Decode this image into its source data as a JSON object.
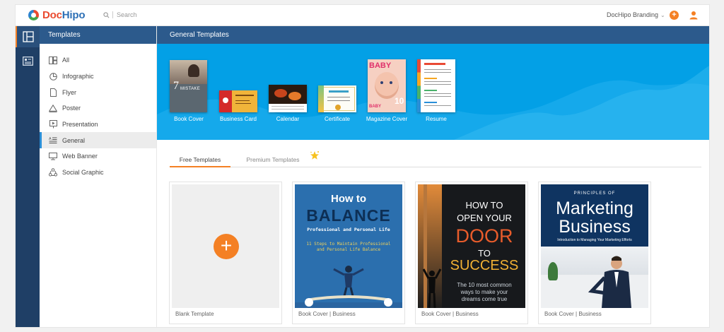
{
  "topbar": {
    "logo_doc": "Doc",
    "logo_hipo": "Hipo",
    "search_placeholder": "Search",
    "brand_label": "DocHipo Branding",
    "plus": "+"
  },
  "sidebar": {
    "title": "Templates",
    "items": [
      {
        "label": "All",
        "icon": "grid-icon"
      },
      {
        "label": "Infographic",
        "icon": "pie-chart-icon"
      },
      {
        "label": "Flyer",
        "icon": "flyer-icon"
      },
      {
        "label": "Poster",
        "icon": "poster-icon"
      },
      {
        "label": "Presentation",
        "icon": "presentation-icon"
      },
      {
        "label": "General",
        "icon": "general-doc-icon"
      },
      {
        "label": "Web Banner",
        "icon": "monitor-icon"
      },
      {
        "label": "Social Graphic",
        "icon": "social-graphic-icon"
      }
    ],
    "active_index": 5
  },
  "main": {
    "title": "General Templates",
    "template_types": [
      {
        "label": "Book Cover"
      },
      {
        "label": "Business Card"
      },
      {
        "label": "Calendar"
      },
      {
        "label": "Certificate"
      },
      {
        "label": "Magazine Cover"
      },
      {
        "label": "Resume"
      }
    ],
    "tabs": [
      {
        "label": "Free Templates",
        "active": true
      },
      {
        "label": "Premium Templates",
        "active": false
      }
    ],
    "cards": [
      {
        "caption": "Blank Template",
        "add": "+"
      },
      {
        "caption": "Book Cover | Business",
        "line1": "How to",
        "line2": "BALANCE",
        "line3": "Professional and Personal Life",
        "line4": "11 Steps to Maintain Professional",
        "line5": "and Personal Life Balance"
      },
      {
        "caption": "Book Cover | Business",
        "line1": "HOW TO",
        "line2": "OPEN YOUR",
        "line3": "DOOR",
        "line4": "TO",
        "line5": "SUCCESS",
        "line6": "The 10 most common",
        "line7": "ways to make your",
        "line8": "dreams come true"
      },
      {
        "caption": "Book Cover | Business",
        "line1": "PRINCIPLES OF",
        "line2": "Marketing",
        "line3": "Business",
        "line4": "Introduction to Managing Your Marketing Efforts"
      }
    ],
    "thumb_text": {
      "book": "7",
      "book_sub": "MISTAKE",
      "baby": "BABY",
      "baby_num": "10"
    }
  },
  "colors": {
    "accent": "#f48024",
    "nav_dark": "#1f3f66",
    "header_blue": "#2c5a8c",
    "banner_blue": "#03a0e6",
    "active_bar": "#2a8fd8"
  }
}
